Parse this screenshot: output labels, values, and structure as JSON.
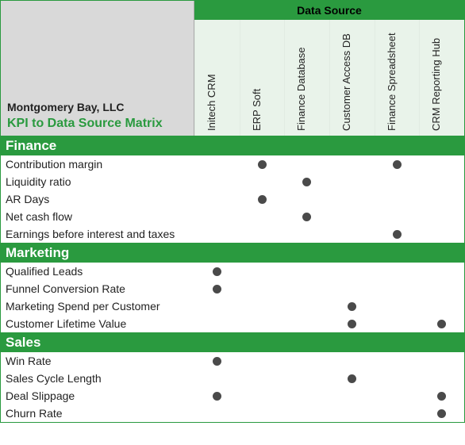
{
  "header": {
    "company": "Montgomery Bay, LLC",
    "subtitle": "KPI to Data Source Matrix",
    "sources_label": "Data Source"
  },
  "sources": [
    "Initech CRM",
    "ERP Soft",
    "Finance Database",
    "Customer Access DB",
    "Finance Spreadsheet",
    "CRM Reporting Hub"
  ],
  "categories": [
    {
      "name": "Finance",
      "rows": [
        {
          "label": "Contribution margin",
          "marks": [
            0,
            1,
            0,
            0,
            1,
            0
          ]
        },
        {
          "label": "Liquidity ratio",
          "marks": [
            0,
            0,
            1,
            0,
            0,
            0
          ]
        },
        {
          "label": "AR Days",
          "marks": [
            0,
            1,
            0,
            0,
            0,
            0
          ]
        },
        {
          "label": "Net cash flow",
          "marks": [
            0,
            0,
            1,
            0,
            0,
            0
          ]
        },
        {
          "label": "Earnings before interest and taxes",
          "marks": [
            0,
            0,
            0,
            0,
            1,
            0
          ]
        }
      ]
    },
    {
      "name": "Marketing",
      "rows": [
        {
          "label": "Qualified Leads",
          "marks": [
            1,
            0,
            0,
            0,
            0,
            0
          ]
        },
        {
          "label": "Funnel Conversion Rate",
          "marks": [
            1,
            0,
            0,
            0,
            0,
            0
          ]
        },
        {
          "label": "Marketing Spend per Customer",
          "marks": [
            0,
            0,
            0,
            1,
            0,
            0
          ]
        },
        {
          "label": "Customer Lifetime Value",
          "marks": [
            0,
            0,
            0,
            1,
            0,
            1
          ]
        }
      ]
    },
    {
      "name": "Sales",
      "rows": [
        {
          "label": "Win Rate",
          "marks": [
            1,
            0,
            0,
            0,
            0,
            0
          ]
        },
        {
          "label": "Sales Cycle Length",
          "marks": [
            0,
            0,
            0,
            1,
            0,
            0
          ]
        },
        {
          "label": "Deal Slippage",
          "marks": [
            1,
            0,
            0,
            0,
            0,
            1
          ]
        },
        {
          "label": "Churn Rate",
          "marks": [
            0,
            0,
            0,
            0,
            0,
            1
          ]
        }
      ]
    }
  ]
}
